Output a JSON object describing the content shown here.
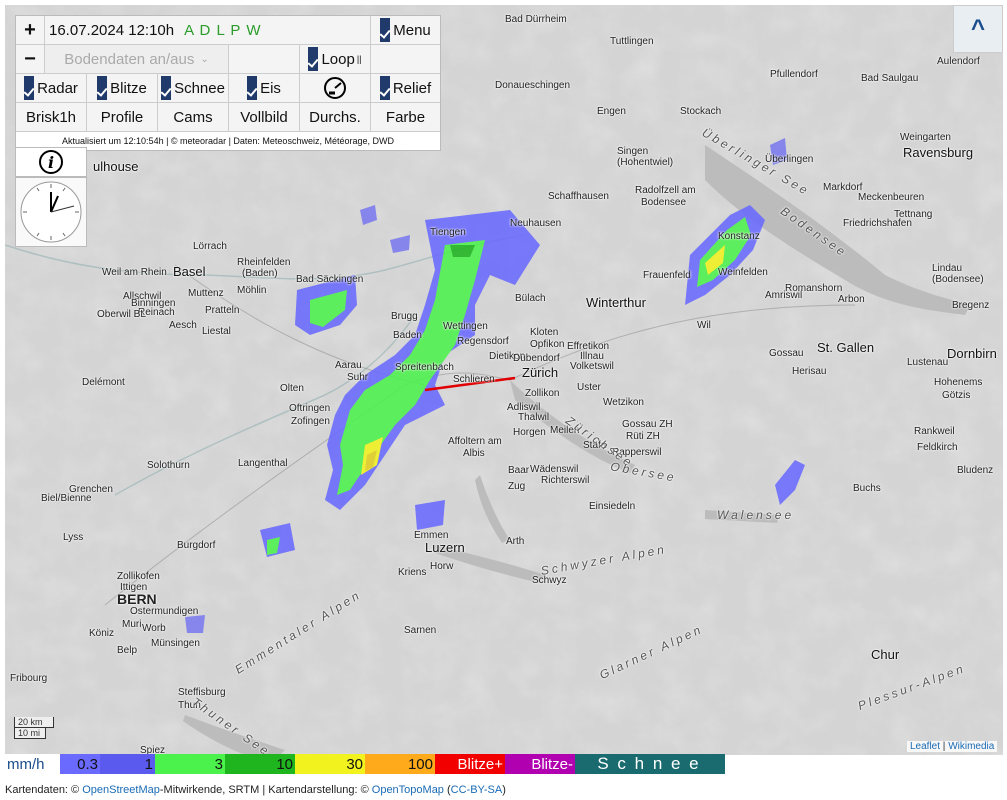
{
  "controls": {
    "zoom_in": "+",
    "zoom_out": "−",
    "datetime": "16.07.2024 12:10h",
    "mode_letters": "A D L P W",
    "menu": "Menu",
    "bodendaten": "Bodendaten an/aus",
    "loop": "Loop",
    "loop_pause": "||",
    "radar": "Radar",
    "blitze": "Blitze",
    "schnee": "Schnee",
    "eis": "Eis",
    "relief": "Relief",
    "brisk": "Brisk1h",
    "profile": "Profile",
    "cams": "Cams",
    "vollbild": "Vollbild",
    "durchs": "Durchs.",
    "farbe": "Farbe",
    "updated": "Aktualisiert um 12:10:54h | © meteoradar | Daten: Meteoschweiz, Météorage, DWD",
    "collapse": "^",
    "info": "i"
  },
  "colors": {
    "mode_letters": "#2a9d2a",
    "checkbox": "#1f3a6b",
    "accent": "#1a4d8c"
  },
  "map": {
    "places": [
      {
        "name": "Bad Dürrheim",
        "cls": ""
      },
      {
        "name": "Bad Saulgau",
        "cls": ""
      },
      {
        "name": "Tuttlingen",
        "cls": ""
      },
      {
        "name": "Aulendorf",
        "cls": ""
      },
      {
        "name": "Donaueschingen",
        "cls": ""
      },
      {
        "name": "Pfullendorf",
        "cls": ""
      },
      {
        "name": "Engen",
        "cls": ""
      },
      {
        "name": "Stockach",
        "cls": ""
      },
      {
        "name": "Singen",
        "cls": ""
      },
      {
        "name": "(Hohentwiel)",
        "cls": ""
      },
      {
        "name": "Überlingen",
        "cls": ""
      },
      {
        "name": "Weingarten",
        "cls": ""
      },
      {
        "name": "Ravensburg",
        "cls": "big"
      },
      {
        "name": "ulhouse",
        "cls": "big"
      },
      {
        "name": "Schaffhausen",
        "cls": ""
      },
      {
        "name": "Radolfzell am",
        "cls": ""
      },
      {
        "name": "Bodensee",
        "cls": ""
      },
      {
        "name": "Markdorf",
        "cls": ""
      },
      {
        "name": "Meckenbeuren",
        "cls": ""
      },
      {
        "name": "Tettnang",
        "cls": ""
      },
      {
        "name": "Friedrichshafen",
        "cls": ""
      },
      {
        "name": "Tiengen",
        "cls": ""
      },
      {
        "name": "Neuhausen",
        "cls": ""
      },
      {
        "name": "Konstanz",
        "cls": ""
      },
      {
        "name": "Lörrach",
        "cls": ""
      },
      {
        "name": "Rheinfelden",
        "cls": ""
      },
      {
        "name": "(Baden)",
        "cls": ""
      },
      {
        "name": "Weil am Rhein",
        "cls": ""
      },
      {
        "name": "Basel",
        "cls": "big"
      },
      {
        "name": "Bad Säckingen",
        "cls": ""
      },
      {
        "name": "Frauenfeld",
        "cls": ""
      },
      {
        "name": "Weinfelden",
        "cls": ""
      },
      {
        "name": "Lindau",
        "cls": ""
      },
      {
        "name": "(Bodensee)",
        "cls": ""
      },
      {
        "name": "Allschwil",
        "cls": ""
      },
      {
        "name": "Muttenz",
        "cls": ""
      },
      {
        "name": "Möhlin",
        "cls": ""
      },
      {
        "name": "Binningen",
        "cls": ""
      },
      {
        "name": "Reinach",
        "cls": ""
      },
      {
        "name": "Pratteln",
        "cls": ""
      },
      {
        "name": "Bülach",
        "cls": ""
      },
      {
        "name": "Winterthur",
        "cls": "big"
      },
      {
        "name": "Amriswil",
        "cls": ""
      },
      {
        "name": "Romanshorn",
        "cls": ""
      },
      {
        "name": "Arbon",
        "cls": ""
      },
      {
        "name": "Bregenz",
        "cls": ""
      },
      {
        "name": "Oberwil BL",
        "cls": ""
      },
      {
        "name": "Aesch",
        "cls": ""
      },
      {
        "name": "Liestal",
        "cls": ""
      },
      {
        "name": "Brugg",
        "cls": ""
      },
      {
        "name": "Baden",
        "cls": ""
      },
      {
        "name": "Wettingen",
        "cls": ""
      },
      {
        "name": "Kloten",
        "cls": ""
      },
      {
        "name": "Opfikon",
        "cls": ""
      },
      {
        "name": "Regensdorf",
        "cls": ""
      },
      {
        "name": "Effretikon",
        "cls": ""
      },
      {
        "name": "Wil",
        "cls": ""
      },
      {
        "name": "Dietikon",
        "cls": ""
      },
      {
        "name": "Dübendorf",
        "cls": ""
      },
      {
        "name": "Illnau",
        "cls": ""
      },
      {
        "name": "Volketswil",
        "cls": ""
      },
      {
        "name": "Gossau",
        "cls": ""
      },
      {
        "name": "St. Gallen",
        "cls": "big"
      },
      {
        "name": "Dornbirn",
        "cls": "big"
      },
      {
        "name": "Delémont",
        "cls": ""
      },
      {
        "name": "Aarau",
        "cls": ""
      },
      {
        "name": "Suhr",
        "cls": ""
      },
      {
        "name": "Spreitenbach",
        "cls": ""
      },
      {
        "name": "Schlieren",
        "cls": ""
      },
      {
        "name": "Zürich",
        "cls": "big"
      },
      {
        "name": "Herisau",
        "cls": ""
      },
      {
        "name": "Lustenau",
        "cls": ""
      },
      {
        "name": "Hohenems",
        "cls": ""
      },
      {
        "name": "Olten",
        "cls": ""
      },
      {
        "name": "Oftringen",
        "cls": ""
      },
      {
        "name": "Zofingen",
        "cls": ""
      },
      {
        "name": "Zollikon",
        "cls": ""
      },
      {
        "name": "Uster",
        "cls": ""
      },
      {
        "name": "Adliswil",
        "cls": ""
      },
      {
        "name": "Thalwil",
        "cls": ""
      },
      {
        "name": "Wetzikon",
        "cls": ""
      },
      {
        "name": "Götzis",
        "cls": ""
      },
      {
        "name": "Affoltern am",
        "cls": ""
      },
      {
        "name": "Albis",
        "cls": ""
      },
      {
        "name": "Horgen",
        "cls": ""
      },
      {
        "name": "Meilen",
        "cls": ""
      },
      {
        "name": "Gossau ZH",
        "cls": ""
      },
      {
        "name": "Rüti ZH",
        "cls": ""
      },
      {
        "name": "Stäfa",
        "cls": ""
      },
      {
        "name": "Rapperswil",
        "cls": ""
      },
      {
        "name": "Rankweil",
        "cls": ""
      },
      {
        "name": "Feldkirch",
        "cls": ""
      },
      {
        "name": "Langenthal",
        "cls": ""
      },
      {
        "name": "Solothurn",
        "cls": ""
      },
      {
        "name": "Grenchen",
        "cls": ""
      },
      {
        "name": "Baar",
        "cls": ""
      },
      {
        "name": "Wädenswil",
        "cls": ""
      },
      {
        "name": "Richterswil",
        "cls": ""
      },
      {
        "name": "Zug",
        "cls": ""
      },
      {
        "name": "Bludenz",
        "cls": ""
      },
      {
        "name": "Buchs",
        "cls": ""
      },
      {
        "name": "Biel/Bienne",
        "cls": ""
      },
      {
        "name": "Einsiedeln",
        "cls": ""
      },
      {
        "name": "Walensee",
        "cls": "region"
      },
      {
        "name": "Lyss",
        "cls": ""
      },
      {
        "name": "Emmen",
        "cls": ""
      },
      {
        "name": "Burgdorf",
        "cls": ""
      },
      {
        "name": "Arth",
        "cls": ""
      },
      {
        "name": "Luzern",
        "cls": "big"
      },
      {
        "name": "Kriens",
        "cls": ""
      },
      {
        "name": "Horw",
        "cls": ""
      },
      {
        "name": "Schwyz",
        "cls": ""
      },
      {
        "name": "Zollikofen",
        "cls": ""
      },
      {
        "name": "Ittigen",
        "cls": ""
      },
      {
        "name": "BERN",
        "cls": "capital"
      },
      {
        "name": "Ostermundigen",
        "cls": ""
      },
      {
        "name": "Köniz",
        "cls": ""
      },
      {
        "name": "Muri",
        "cls": ""
      },
      {
        "name": "Worb",
        "cls": ""
      },
      {
        "name": "Belp",
        "cls": ""
      },
      {
        "name": "Münsingen",
        "cls": ""
      },
      {
        "name": "Sarnen",
        "cls": ""
      },
      {
        "name": "Chur",
        "cls": "big"
      },
      {
        "name": "Fribourg",
        "cls": ""
      },
      {
        "name": "Steffisburg",
        "cls": ""
      },
      {
        "name": "Thun",
        "cls": ""
      },
      {
        "name": "Spiez",
        "cls": ""
      },
      {
        "name": "Emmentaler Alpen",
        "cls": "region"
      },
      {
        "name": "Schwyzer Alpen",
        "cls": "region"
      },
      {
        "name": "Glarner Alpen",
        "cls": "region"
      },
      {
        "name": "Plessur-Alpen",
        "cls": "region"
      },
      {
        "name": "Bodensee",
        "cls": "region"
      },
      {
        "name": "Zürichsee",
        "cls": "region"
      },
      {
        "name": "Obersee",
        "cls": "region"
      },
      {
        "name": "Thuner See",
        "cls": "region"
      },
      {
        "name": "Überlinger See",
        "cls": "region"
      }
    ],
    "scale_km": "20 km",
    "scale_mi": "10 mi",
    "attribution_leaflet": "Leaflet",
    "attribution_sep": " | ",
    "attribution_wikimedia": "Wikimedia"
  },
  "legend": [
    {
      "label": "mm/h",
      "bg": "#ffffff",
      "fg": "#1a4d8c",
      "width": 55
    },
    {
      "label": "0.3",
      "bg": "#6a6aff",
      "fg": "#111111",
      "width": 40
    },
    {
      "label": "1",
      "bg": "#5a5aee",
      "fg": "#111111",
      "width": 55
    },
    {
      "label": "3",
      "bg": "#4cf24c",
      "fg": "#111111",
      "width": 70
    },
    {
      "label": "10",
      "bg": "#1fb51f",
      "fg": "#111111",
      "width": 70
    },
    {
      "label": "30",
      "bg": "#f2f21f",
      "fg": "#111111",
      "width": 70
    },
    {
      "label": "100",
      "bg": "#ffaa1a",
      "fg": "#111111",
      "width": 70
    },
    {
      "label": "Blitze+",
      "bg": "#f20000",
      "fg": "#ffffff",
      "width": 70
    },
    {
      "label": "Blitze-",
      "bg": "#b000b0",
      "fg": "#ffffff",
      "width": 70
    },
    {
      "label": "S c h n e e",
      "bg": "#1a6b70",
      "fg": "#ffffff",
      "width": 150
    }
  ],
  "footer": {
    "prefix": "Kartendaten: © ",
    "osm": "OpenStreetMap",
    "mid": "-Mitwirkende, SRTM | Kartendarstellung: © ",
    "otm": "OpenTopoMap",
    "open": " (",
    "license": "CC-BY-SA",
    "close": ")"
  }
}
